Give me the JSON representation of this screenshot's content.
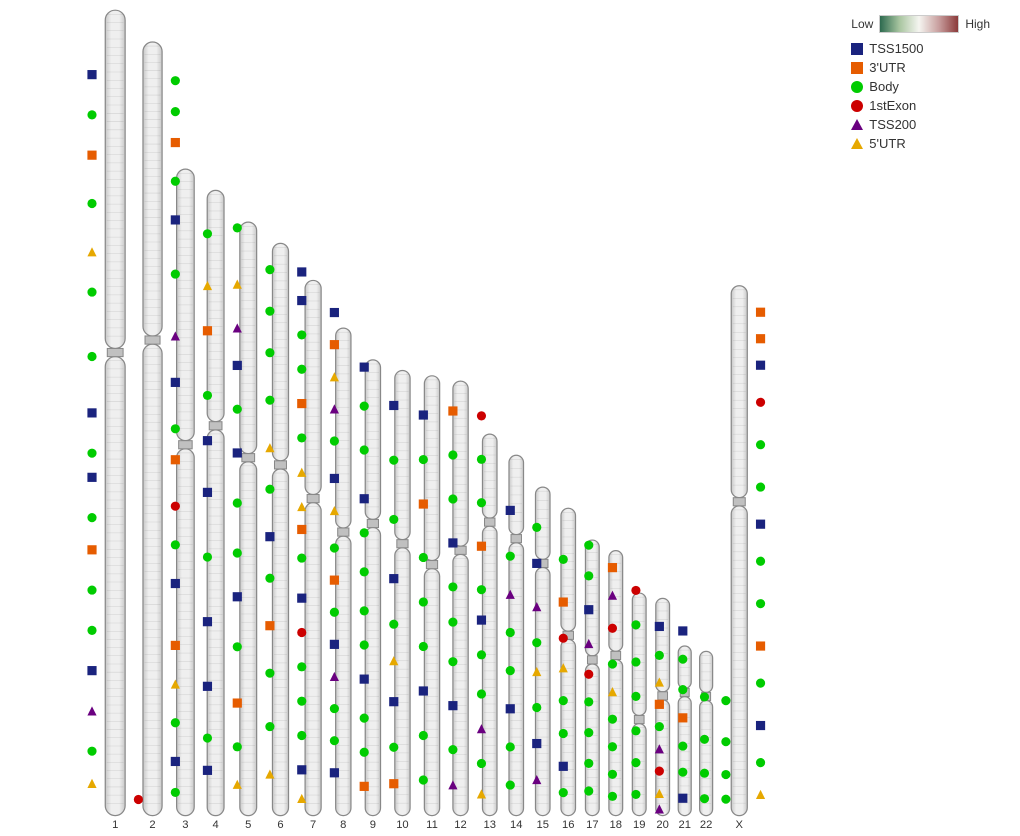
{
  "legend": {
    "gradient_label_low": "Low",
    "gradient_label_high": "High",
    "items": [
      {
        "label": "TSS1500",
        "type": "square",
        "color": "#1a237e"
      },
      {
        "label": "3'UTR",
        "type": "square",
        "color": "#e65c00"
      },
      {
        "label": "Body",
        "type": "circle",
        "color": "#00cc00"
      },
      {
        "label": "1stExon",
        "type": "circle",
        "color": "#cc0000"
      },
      {
        "label": "TSS200",
        "type": "triangle-up",
        "color": "#6a0080"
      },
      {
        "label": "5'UTR",
        "type": "triangle-up",
        "color": "#e6a800"
      }
    ]
  },
  "chromosomes": [
    {
      "id": "1",
      "label": "1",
      "relWidth": 18,
      "relHeight": 760
    },
    {
      "id": "2",
      "label": "2",
      "relWidth": 17,
      "relHeight": 730
    },
    {
      "id": "3",
      "label": "3",
      "relWidth": 15,
      "relHeight": 610
    },
    {
      "id": "4",
      "label": "4",
      "relWidth": 14,
      "relHeight": 590
    },
    {
      "id": "5",
      "label": "5",
      "relWidth": 14,
      "relHeight": 560
    },
    {
      "id": "6",
      "label": "6",
      "relWidth": 13,
      "relHeight": 540
    },
    {
      "id": "7",
      "label": "7",
      "relWidth": 13,
      "relHeight": 505
    },
    {
      "id": "8",
      "label": "8",
      "relWidth": 12,
      "relHeight": 460
    },
    {
      "id": "9",
      "label": "9",
      "relWidth": 12,
      "relHeight": 430
    },
    {
      "id": "10",
      "label": "10",
      "relWidth": 12,
      "relHeight": 420
    },
    {
      "id": "11",
      "label": "11",
      "relWidth": 12,
      "relHeight": 415
    },
    {
      "id": "12",
      "label": "12",
      "relWidth": 12,
      "relHeight": 410
    },
    {
      "id": "13",
      "label": "13",
      "relWidth": 11,
      "relHeight": 360
    },
    {
      "id": "14",
      "label": "14",
      "relWidth": 11,
      "relHeight": 340
    },
    {
      "id": "15",
      "label": "15",
      "relWidth": 11,
      "relHeight": 310
    },
    {
      "id": "16",
      "label": "16",
      "relWidth": 11,
      "relHeight": 290
    },
    {
      "id": "17",
      "label": "17",
      "relWidth": 10,
      "relHeight": 260
    },
    {
      "id": "18",
      "label": "18",
      "relWidth": 10,
      "relHeight": 250
    },
    {
      "id": "19",
      "label": "19",
      "relWidth": 10,
      "relHeight": 210
    },
    {
      "id": "20",
      "label": "20",
      "relWidth": 10,
      "relHeight": 205
    },
    {
      "id": "21",
      "label": "21",
      "relWidth": 9,
      "relHeight": 160
    },
    {
      "id": "22",
      "label": "22",
      "relWidth": 9,
      "relHeight": 155
    },
    {
      "id": "X",
      "label": "X",
      "relWidth": 13,
      "relHeight": 500
    }
  ]
}
